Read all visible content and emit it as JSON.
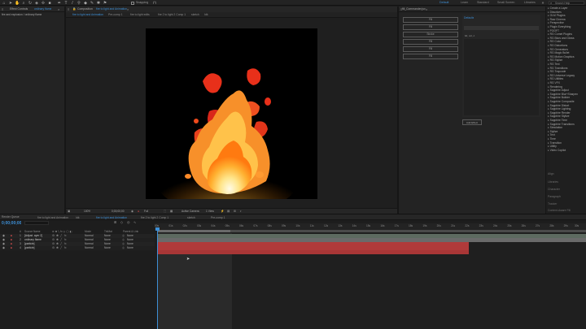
{
  "top_toolbar": {
    "snapping_label": "Snapping",
    "search_placeholder": "Search Help"
  },
  "workspaces": [
    "Default",
    "Learn",
    "Standard",
    "Small Screen",
    "Libraries"
  ],
  "project_panel": {
    "tab_label": "Effect Controls",
    "comp_name": "ordinary flame",
    "line2": "fire and explosion / ordinary flame"
  },
  "composition_panel": {
    "tab_label": "Composition",
    "comp_name": "fire to light and Animation",
    "view_tabs": [
      "fire to light and Animation",
      "Pre-comp 1",
      "fire to light edits",
      "fire 2 to light 2 Comp 1",
      "sketch",
      "Idk"
    ],
    "footer": {
      "zoom": "100%",
      "timecode": "0;00;00;00",
      "resolution": "Full",
      "camera": "Active Camera",
      "views": "1 View"
    }
  },
  "script_panel": {
    "tab_label": "fill_Commander.jsx",
    "buttons": [
      "Fill",
      "Fill",
      "Stroke",
      "Fill",
      "Fill",
      "Fill"
    ]
  },
  "inner_panel": {
    "title": "Defaults",
    "row_label": "ltd, col, d",
    "add_button": "Add Effect"
  },
  "effects_panel": {
    "items": [
      "Create a Layer",
      "Dissolves",
      "OLM Plugins",
      "Raw Cinema",
      "Perspective",
      "Plugin Everything",
      "POOFT",
      "RG Comet Plugins",
      "RG Blurs and Glows",
      "RG Color",
      "RG Distortions",
      "RG Generators",
      "RG Magic Bullet",
      "RG Motion Graphics",
      "RG Stylize",
      "RG Text",
      "RG Transitions",
      "RG Trapcode",
      "RG Universe Legacy",
      "RG Utilities",
      "RG VFX",
      "Rendering",
      "Sapphire Adjust",
      "Sapphire Blur+Sharpen",
      "Sapphire Builder",
      "Sapphire Composite",
      "Sapphire Distort",
      "Sapphire Lighting",
      "Sapphire Render",
      "Sapphire Stylize",
      "Sapphire Time",
      "Sapphire Transitions",
      "Simulation",
      "Stylize",
      "Text",
      "Time",
      "Transition",
      "Utility",
      "Video Copilot"
    ],
    "sub_panels": [
      "Align",
      "Libraries",
      "Character",
      "Paragraph",
      "Tracker",
      "Content-Aware Fill"
    ]
  },
  "timeline": {
    "timecode": "0;00;00;00",
    "tabs": [
      "fire to light and Animation",
      "Idk",
      "fire to light and Animation",
      "fire 2 to light 2 Comp 1",
      "sketch",
      "Pre-comp 1",
      "Render Queue"
    ],
    "columns": {
      "number": "#",
      "source": "Source Name",
      "mode": "Mode",
      "trkmat": "TrkMat",
      "parent": "Parent & Link"
    },
    "layers": [
      {
        "num": "1",
        "name": "[Adjust. ayer 2]",
        "mode": "Normal",
        "trk": "None",
        "parent": "None"
      },
      {
        "num": "2",
        "name": "ordinary flame",
        "mode": "Normal",
        "trk": "None",
        "parent": "None"
      },
      {
        "num": "3",
        "name": "[particle]",
        "mode": "Normal",
        "trk": "None",
        "parent": "None"
      },
      {
        "num": "4",
        "name": "[particle]",
        "mode": "Normal",
        "trk": "None",
        "parent": "None"
      }
    ],
    "ruler": [
      "00s",
      "01s",
      "02s",
      "03s",
      "04s",
      "05s",
      "06s",
      "07s",
      "08s",
      "09s",
      "10s",
      "11s",
      "12s",
      "13s",
      "14s",
      "15s",
      "16s",
      "17s",
      "18s",
      "19s",
      "20s",
      "21s",
      "22s",
      "23s",
      "24s",
      "25s",
      "26s",
      "27s",
      "28s",
      "29s",
      "30s"
    ]
  },
  "colors": {
    "accent": "#3d8fd6",
    "layer_bar": "#b03a3a",
    "playhead": "#3d8fd6"
  }
}
